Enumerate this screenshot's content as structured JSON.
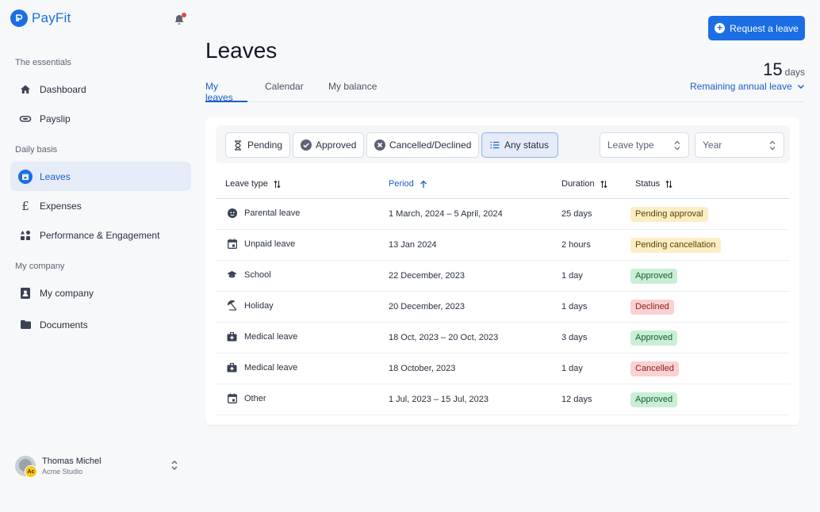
{
  "brand": {
    "name": "PayFit",
    "color": "#1b6ee3"
  },
  "sidebar": {
    "sections": [
      {
        "title": "The essentials"
      },
      {
        "title": "Daily basis"
      },
      {
        "title": "My company"
      }
    ],
    "items": [
      {
        "label": "Dashboard",
        "icon": "home-icon"
      },
      {
        "label": "Payslip",
        "icon": "payslip-icon"
      },
      {
        "label": "Leaves",
        "icon": "calendar-icon",
        "active": true
      },
      {
        "label": "Expenses",
        "icon": "pound-icon"
      },
      {
        "label": "Performance & Engagement",
        "icon": "shapes-icon"
      },
      {
        "label": "My company",
        "icon": "contact-card-icon"
      },
      {
        "label": "Documents",
        "icon": "folder-icon"
      }
    ],
    "user": {
      "name": "Thomas Michel",
      "org": "Acme Studio",
      "badge": "Ac"
    }
  },
  "header": {
    "title": "Leaves",
    "request_label": "Request a leave",
    "tabs": [
      {
        "label": "My leaves",
        "active": true
      },
      {
        "label": "Calendar"
      },
      {
        "label": "My balance"
      }
    ],
    "balance": {
      "value": "15",
      "unit": "days",
      "link": "Remaining annual leave"
    }
  },
  "filters": {
    "chips": [
      {
        "label": "Pending",
        "icon": "hourglass-icon"
      },
      {
        "label": "Approved",
        "icon": "check-circle-icon"
      },
      {
        "label": "Cancelled/Declined",
        "icon": "x-circle-icon"
      },
      {
        "label": "Any status",
        "icon": "list-icon",
        "active": true
      }
    ],
    "leave_type_placeholder": "Leave type",
    "year_placeholder": "Year"
  },
  "table": {
    "columns": [
      {
        "label": "Leave type"
      },
      {
        "label": "Period",
        "sorted": true
      },
      {
        "label": "Duration"
      },
      {
        "label": "Status"
      }
    ],
    "rows": [
      {
        "type": "Parental leave",
        "icon": "baby-icon",
        "period": "1 March, 2024 –  5 April, 2024",
        "duration": "25 days",
        "status": "Pending approval",
        "status_kind": "pending"
      },
      {
        "type": "Unpaid leave",
        "icon": "calendar-icon",
        "period": "13 Jan 2024",
        "duration": "2 hours",
        "status": "Pending cancellation",
        "status_kind": "pending"
      },
      {
        "type": "School",
        "icon": "graduation-cap-icon",
        "period": "22 December, 2023",
        "duration": "1 day",
        "status": "Approved",
        "status_kind": "approved"
      },
      {
        "type": "Holiday",
        "icon": "beach-umbrella-icon",
        "period": "20 December, 2023",
        "duration": "1 days",
        "status": "Declined",
        "status_kind": "declined"
      },
      {
        "type": "Medical leave",
        "icon": "medical-kit-icon",
        "period": "18 Oct, 2023 – 20 Oct, 2023",
        "duration": "3 days",
        "status": "Approved",
        "status_kind": "approved"
      },
      {
        "type": "Medical leave",
        "icon": "medical-kit-icon",
        "period": "18 October, 2023",
        "duration": "1 day",
        "status": "Cancelled",
        "status_kind": "declined"
      },
      {
        "type": "Other",
        "icon": "calendar-icon",
        "period": "1 Jul, 2023 – 15 Jul, 2023",
        "duration": "12 days",
        "status": "Approved",
        "status_kind": "approved"
      }
    ]
  },
  "colors": {
    "accent": "#1b6ee3",
    "pending": "#fdedc4",
    "approved": "#c9efd5",
    "declined": "#fbd1d1"
  }
}
